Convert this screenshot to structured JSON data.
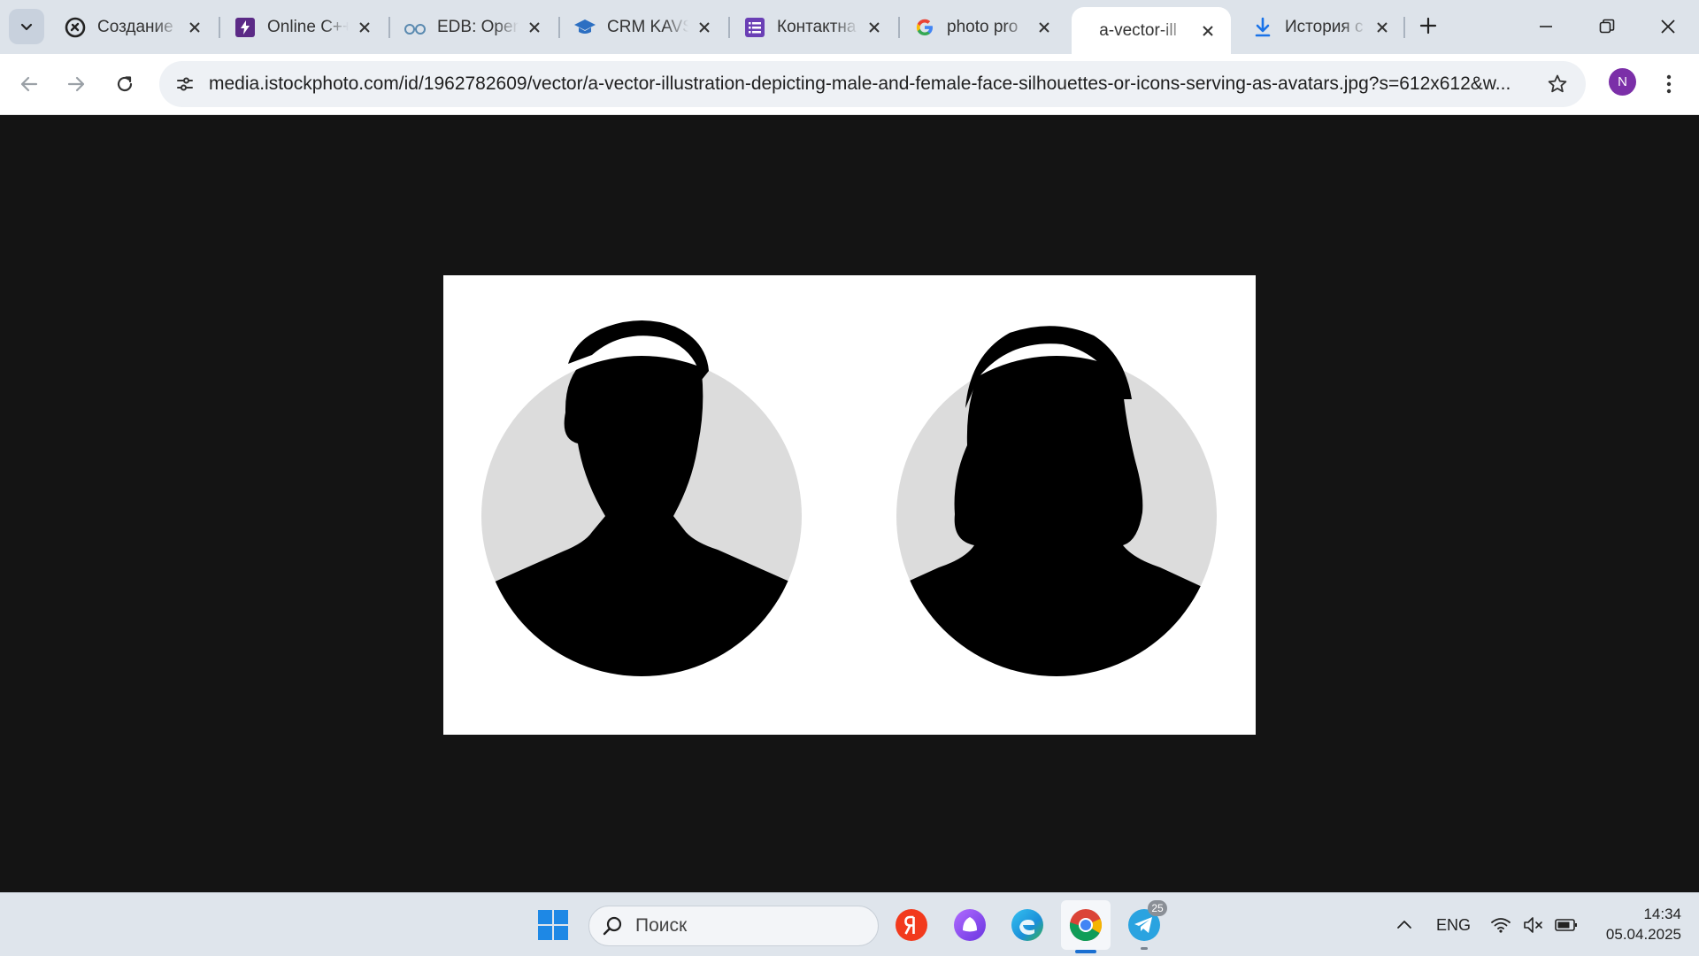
{
  "browser": {
    "tabs": [
      {
        "title": "Создание",
        "favicon": "loop-logo-icon",
        "active": false
      },
      {
        "title": "Online C++",
        "favicon": "bolt-icon",
        "active": false
      },
      {
        "title": "EDB: Open",
        "favicon": "glasses-icon",
        "active": false
      },
      {
        "title": "CRM KAVS",
        "favicon": "graduation-cap-icon",
        "active": false
      },
      {
        "title": "Контактна",
        "favicon": "form-list-icon",
        "active": false
      },
      {
        "title": "photo pro",
        "favicon": "google-icon",
        "active": false
      },
      {
        "title": "a-vector-ill",
        "favicon": "",
        "active": true
      },
      {
        "title": "История с",
        "favicon": "download-icon",
        "active": false
      }
    ],
    "url": "media.istockphoto.com/id/1962782609/vector/a-vector-illustration-depicting-male-and-female-face-silhouettes-or-icons-serving-as-avatars.jpg?s=612x612&w...",
    "profile_initial": "N",
    "colors": {
      "tabstrip": "#dde3ea",
      "page_background": "#141414",
      "avatar_circle": "#dcdcdc",
      "silhouette": "#000000",
      "profile": "#7b2fa8"
    }
  },
  "taskbar": {
    "search_label": "Поиск",
    "telegram_badge": "25",
    "language": "ENG",
    "time": "14:34",
    "date": "05.04.2025"
  }
}
